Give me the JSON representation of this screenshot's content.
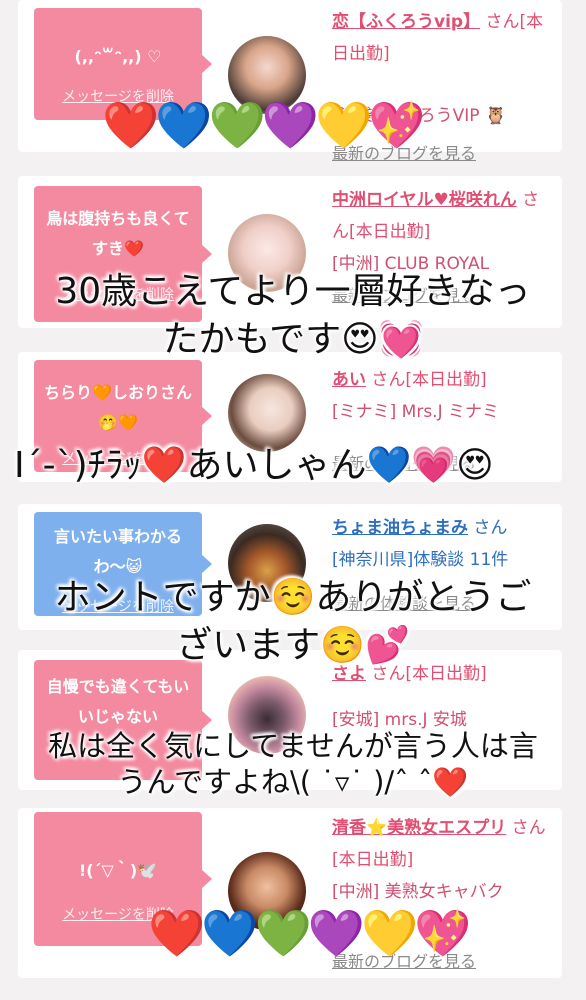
{
  "cards": [
    {
      "message": "(,,ᵔ꒳ᵔ,,) ♡",
      "delete_label": "メッセージを削除",
      "bubble_color": "pink",
      "name": "恋【ふくろうvip】",
      "name_suffix": "さん[本日出勤]",
      "area": "[池袋] ふくろうVIP 🦉",
      "link": "最新のブログを見る"
    },
    {
      "message": "鳥は腹持ちも良くてすき❤️",
      "delete_label": "メッセージを削除",
      "bubble_color": "pink",
      "name": "中洲ロイヤル♥桜咲れん",
      "name_suffix": "さん[本日出勤]",
      "area": "[中洲] CLUB ROYAL",
      "link": "最新のブログを見る"
    },
    {
      "message": "ちらり🧡しおりさん🤭🧡",
      "delete_label": "メッセージを削除",
      "bubble_color": "pink",
      "name": "あい",
      "name_suffix": "さん[本日出勤]",
      "area": "[ミナミ] Mrs.J ミナミ",
      "link": "最新のブログを見る"
    },
    {
      "message": "言いたい事わかるわ〜😺",
      "delete_label": "メッセージを削除",
      "bubble_color": "blue",
      "name": "ちょま油ちょまみ",
      "name_suffix": "さん",
      "area": "[神奈川県]体験談 11件",
      "link": "最新の体験談を見る"
    },
    {
      "message": "自慢でも違くてもいいじゃない",
      "delete_label": "メッセージを削除",
      "bubble_color": "pink",
      "name": "さよ",
      "name_suffix": "さん[本日出勤]",
      "area": "[安城] mrs.J 安城",
      "link": "最新のブログを見る"
    },
    {
      "message": "!(´▽｀)🕊️",
      "delete_label": "メッセージを削除",
      "bubble_color": "pink",
      "name": "清香⭐美熟女エスプリ",
      "name_suffix": "さん[本日出勤]",
      "area": "[中洲] 美熟女キャバク",
      "link": "最新のブログを見る"
    }
  ],
  "overlays": {
    "line1": "30歳こえてより一層好きなっ",
    "line2": "たかもです😍💓",
    "line3": "I´-`)ﾁﾗｯ❤️あいしゃん💙💗😍",
    "line4": "ホントですか☺️ありがとうご",
    "line5": "ざいます☺️💕",
    "line6": "私は全く気にしてませんが言う人は言",
    "line7": "うんですよね\\( ˙▿˙ )/ˆ ˆ❤️",
    "hearts_top": "❤️💙💚💜💛💖",
    "hearts_bottom": "❤️💙💚💜💛💖"
  },
  "colors": {
    "accent": "#e04f72",
    "bubble_pink": "#f48aa0",
    "bubble_blue": "#7fb0ee",
    "link_gray": "#8a8a8a"
  }
}
